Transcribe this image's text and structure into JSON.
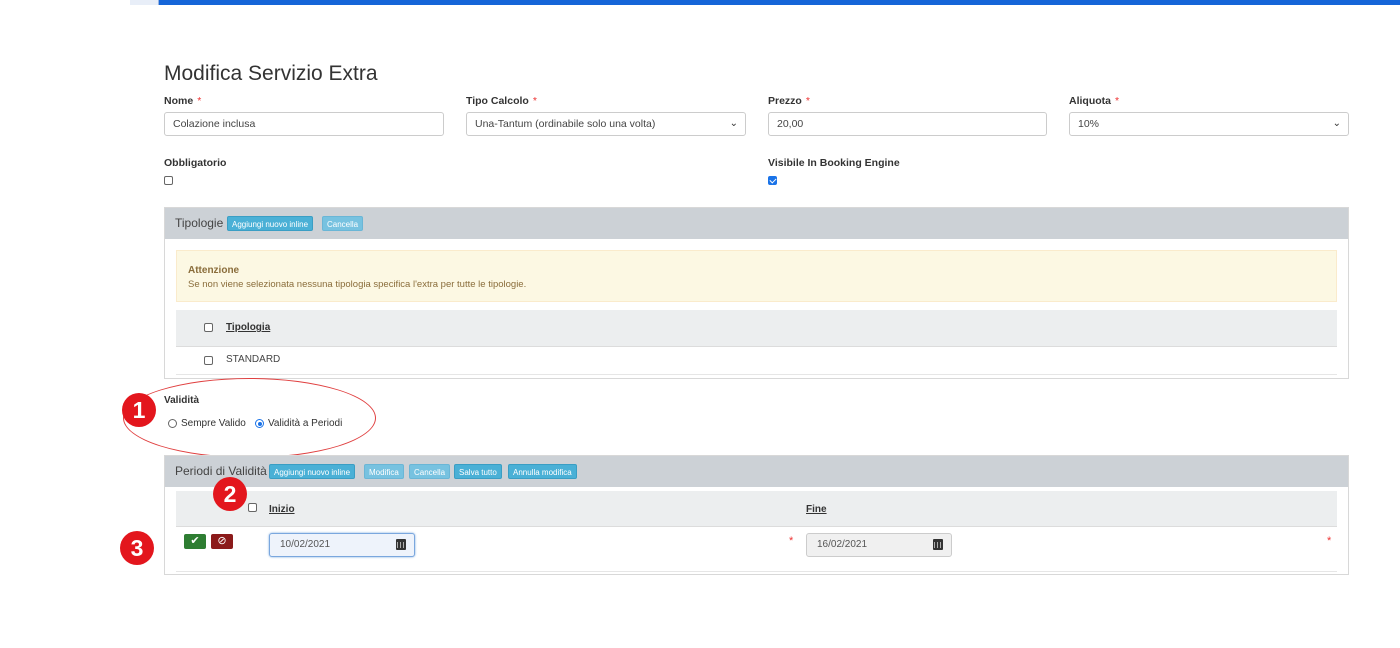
{
  "page_title": "Modifica Servizio Extra",
  "fields": {
    "nome": {
      "label": "Nome",
      "required": "*",
      "value": "Colazione inclusa"
    },
    "tipo_calcolo": {
      "label": "Tipo Calcolo",
      "required": "*",
      "value": "Una-Tantum (ordinabile solo una volta)"
    },
    "prezzo": {
      "label": "Prezzo",
      "required": "*",
      "value": "20,00"
    },
    "aliquota": {
      "label": "Aliquota",
      "required": "*",
      "value": "10%"
    },
    "obbligatorio": {
      "label": "Obbligatorio",
      "checked": false
    },
    "visibile": {
      "label": "Visibile In Booking Engine",
      "checked": true
    }
  },
  "tipologie": {
    "title": "Tipologie",
    "btn_add": "Aggiungi nuovo inline",
    "btn_delete": "Cancella",
    "alert_title": "Attenzione",
    "alert_text": "Se non viene selezionata nessuna tipologia specifica l'extra per tutte le tipologie.",
    "col_header": "Tipologia",
    "rows": [
      "STANDARD"
    ]
  },
  "validita": {
    "label": "Validità",
    "options": [
      "Sempre Valido",
      "Validità a Periodi"
    ],
    "selected": "Validità a Periodi"
  },
  "periodi": {
    "title": "Periodi di Validità",
    "buttons": [
      "Aggiungi nuovo inline",
      "Modifica",
      "Cancella",
      "Salva tutto",
      "Annulla modifica"
    ],
    "col_inizio": "Inizio",
    "col_fine": "Fine",
    "rows": [
      {
        "inizio": "10/02/2021",
        "fine": "16/02/2021",
        "required": "*"
      }
    ]
  },
  "markers": [
    "1",
    "2",
    "3"
  ],
  "colors": {
    "accent": "#1565d8",
    "info_button": "#4ab0d6",
    "confirm": "#2e7d32",
    "cancel": "#8b1a1a",
    "marker": "#e3161d"
  },
  "icons": {
    "confirm": "check-icon",
    "cancel": "ban-icon",
    "date": "calendar-icon"
  }
}
